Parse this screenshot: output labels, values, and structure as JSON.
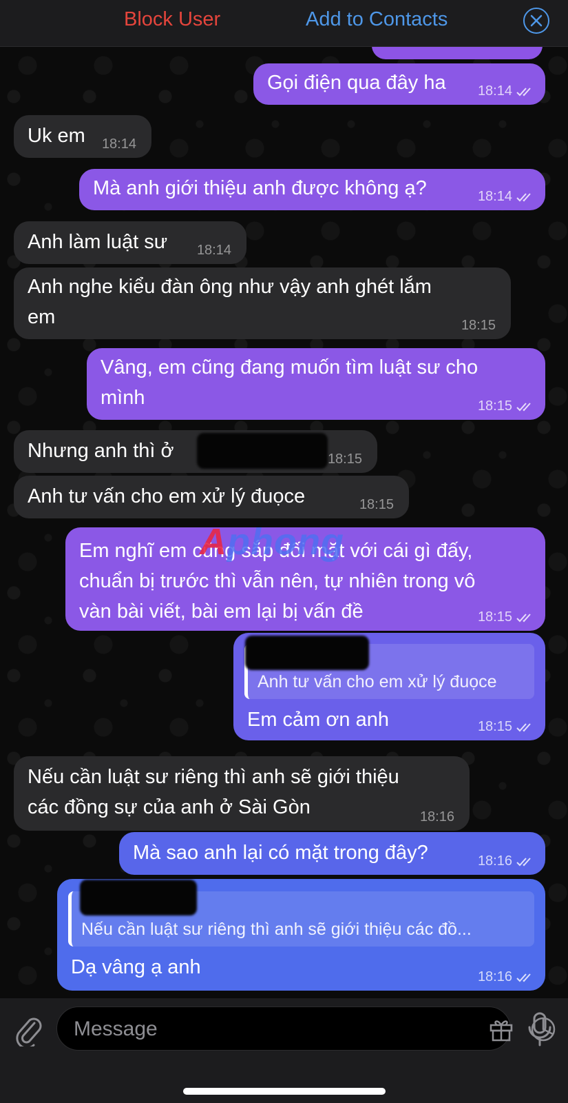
{
  "topbar": {
    "block_label": "Block User",
    "add_label": "Add to Contacts"
  },
  "messages": [
    {
      "dir": "out",
      "text": "Gọi điện qua đây ha",
      "time": "18:14"
    },
    {
      "dir": "in",
      "text": "Uk em",
      "time": "18:14"
    },
    {
      "dir": "out",
      "text": "Mà anh giới thiệu anh được không ạ?",
      "time": "18:14"
    },
    {
      "dir": "in",
      "text": "Anh làm luật sư",
      "time": "18:14"
    },
    {
      "dir": "in",
      "text": "Anh nghe kiểu đàn ông như vậy anh ghét lắm em",
      "lines": [
        "Anh nghe kiểu đàn ông như vậy anh ghét lắm",
        "em"
      ],
      "time": "18:15"
    },
    {
      "dir": "out",
      "text": "Vâng, em cũng đang muốn tìm luật sư cho mình",
      "lines": [
        "Vâng, em cũng đang muốn tìm luật sư cho",
        "mình"
      ],
      "time": "18:15"
    },
    {
      "dir": "in",
      "text": "Nhưng anh thì ở",
      "time": "18:15"
    },
    {
      "dir": "in",
      "text": "Anh tư vấn cho em xử lý đuọce",
      "time": "18:15"
    },
    {
      "dir": "out",
      "text": "Em nghĩ em cũng sắp đối mặt với cái gì đấy, chuẩn bị trước thì vẫn nên, tự nhiên trong vô vàn bài viết, bài em lại bị vấn đề",
      "lines": [
        "Em nghĩ em cũng sắp đối mặt với cái gì đấy,",
        "chuẩn bị trước thì vẫn nên, tự nhiên trong vô",
        "vàn bài viết, bài em lại bị vấn đề"
      ],
      "time": "18:15"
    },
    {
      "dir": "out",
      "reply_to": "Anh tư vấn cho em xử lý đuọce",
      "text": "Em cảm ơn anh",
      "time": "18:15"
    },
    {
      "dir": "in",
      "text": "Nếu cần luật sư riêng thì anh sẽ giới thiệu các đồng sự của anh ở Sài Gòn",
      "lines": [
        "Nếu cần luật sư riêng thì anh sẽ giới thiệu",
        "các đồng sự của anh ở Sài Gòn"
      ],
      "time": "18:16"
    },
    {
      "dir": "out",
      "text": "Mà sao anh lại có mặt trong đây?",
      "time": "18:16"
    },
    {
      "dir": "out",
      "reply_to": "Nếu cần luật sư riêng thì anh sẽ giới thiệu các đồ...",
      "text": "Dạ vâng ạ anh",
      "time": "18:16"
    }
  ],
  "watermark": {
    "a": "A",
    "rest": "phong"
  },
  "input": {
    "placeholder": "Message"
  },
  "icons": {
    "close": "close-circle-icon",
    "attach": "paperclip-icon",
    "gift": "gift-icon",
    "sticker": "sticker-icon",
    "mic": "microphone-icon",
    "read": "double-check-icon"
  },
  "colors": {
    "outgoing": "#8b58e6",
    "incoming": "#2a2a2c",
    "block": "#e5453c",
    "add": "#4e97e8"
  }
}
